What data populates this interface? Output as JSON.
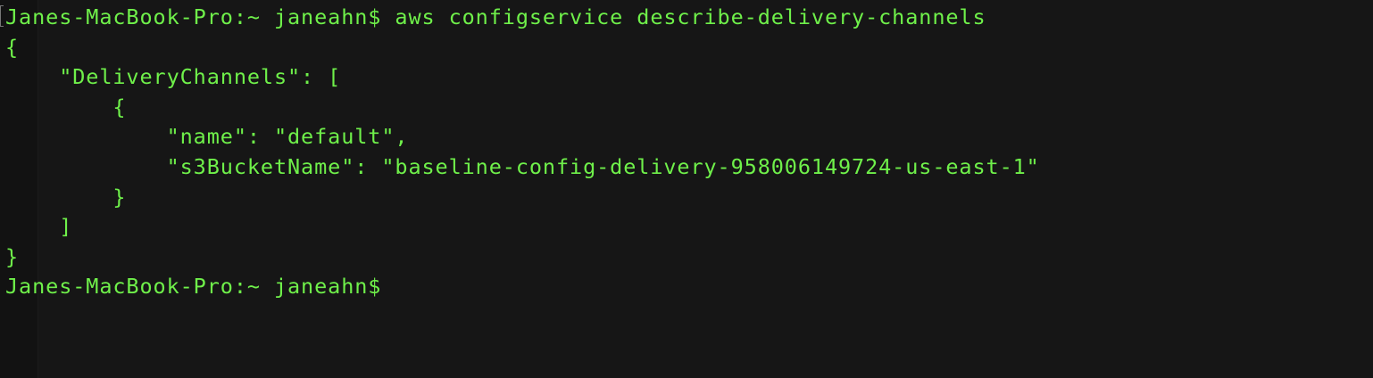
{
  "terminal": {
    "text_color": "#6ff04a",
    "background_color": "#161616",
    "lines": [
      "Janes-MacBook-Pro:~ janeahn$ aws configservice describe-delivery-channels",
      "{",
      "    \"DeliveryChannels\": [",
      "        {",
      "            \"name\": \"default\",",
      "            \"s3BucketName\": \"baseline-config-delivery-958006149724-us-east-1\"",
      "        }",
      "    ]",
      "}",
      "Janes-MacBook-Pro:~ janeahn$ "
    ]
  }
}
